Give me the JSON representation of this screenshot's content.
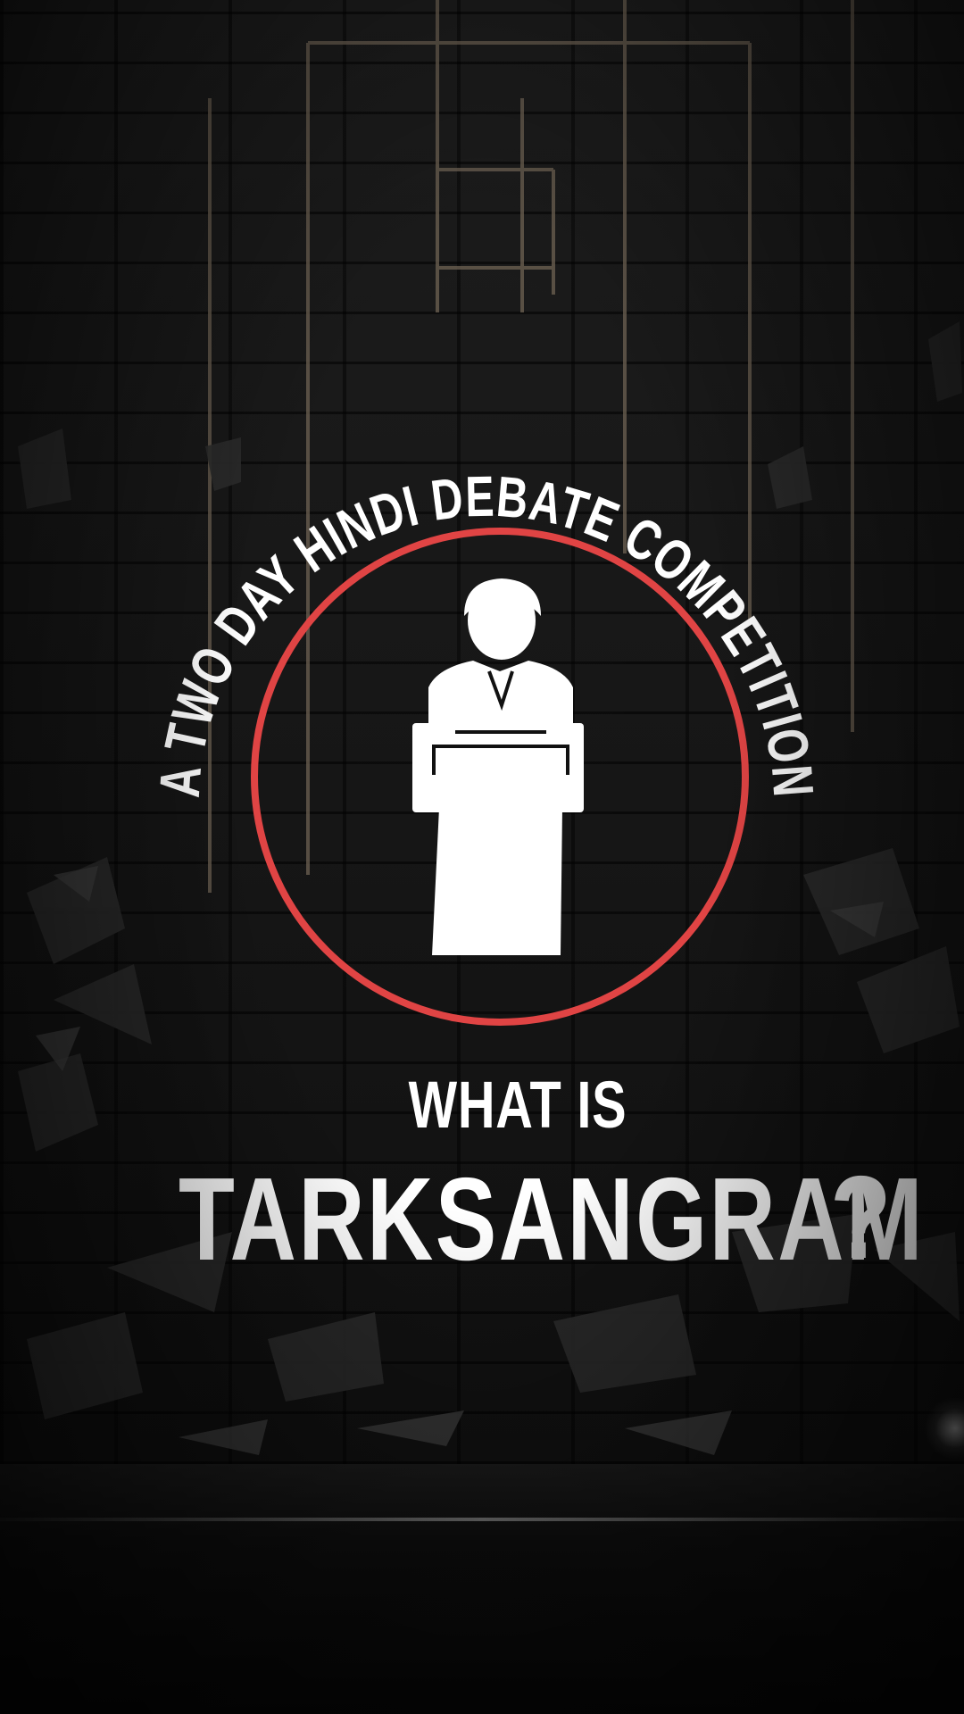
{
  "emblem": {
    "arc_text": "A TWO DAY HINDI DEBATE COMPETITION",
    "ring_color": "#e04444",
    "icon": "speaker-at-podium-icon"
  },
  "headline": {
    "kicker": "WHAT IS",
    "title": "TARKSANGRAM",
    "question_mark": "?"
  },
  "colors": {
    "text": "#ffffff",
    "background": "#0b0b0b"
  }
}
